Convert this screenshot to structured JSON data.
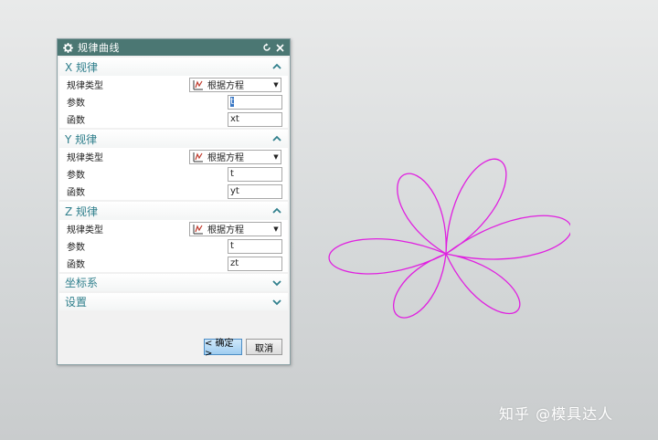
{
  "dialog": {
    "title": "规律曲线",
    "ok_label": "< 确定 >",
    "cancel_label": "取消"
  },
  "sections": {
    "x": {
      "header": "X 规律",
      "type_label": "规律类型",
      "type_value": "根据方程",
      "param_label": "参数",
      "param_value": "t",
      "func_label": "函数",
      "func_value": "xt"
    },
    "y": {
      "header": "Y 规律",
      "type_label": "规律类型",
      "type_value": "根据方程",
      "param_label": "参数",
      "param_value": "t",
      "func_label": "函数",
      "func_value": "yt"
    },
    "z": {
      "header": "Z 规律",
      "type_label": "规律类型",
      "type_value": "根据方程",
      "param_label": "参数",
      "param_value": "t",
      "func_label": "函数",
      "func_value": "zt"
    },
    "csys": {
      "header": "坐标系"
    },
    "settings": {
      "header": "设置"
    }
  },
  "curve": {
    "color": "#e020e0",
    "petals": 6
  },
  "watermark": "知乎 @模具达人",
  "colors": {
    "titlebar": "#4b7773",
    "section_header": "#2f7f8c",
    "ok_button": "#9fcdf0"
  }
}
